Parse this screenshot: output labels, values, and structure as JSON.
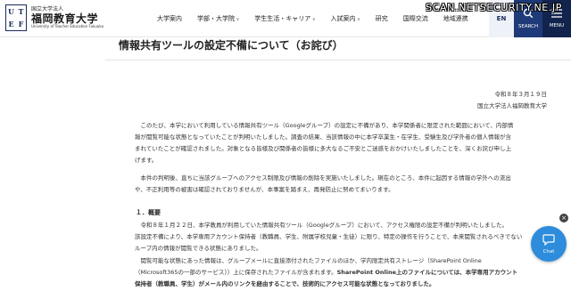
{
  "header": {
    "logo": {
      "mark": [
        "U",
        "T",
        "E",
        "F"
      ],
      "small": "国立大学法人",
      "name": "福岡教育大学",
      "en": "University of Teacher Education Fukuoka"
    },
    "nav": [
      {
        "label": "大学案内",
        "chevron": false
      },
      {
        "label": "学部・大学院",
        "chevron": true
      },
      {
        "label": "学生生活・キャリア",
        "chevron": true
      },
      {
        "label": "入試案内",
        "chevron": true
      },
      {
        "label": "研究",
        "chevron": false
      },
      {
        "label": "国際交流",
        "chevron": false
      },
      {
        "label": "地域連携",
        "chevron": false
      }
    ],
    "lang_label": "EN",
    "search_label": "SEARCH",
    "menu_label": "MENU"
  },
  "overlay_text": "SCAN.NETSECURITY.NE.JP",
  "icons": {
    "search": "search-icon",
    "menu": "menu-icon",
    "chat": "chat-icon",
    "close": "close-icon"
  },
  "article": {
    "title": "情報共有ツールの設定不備について（お詫び）",
    "date": "令和８年３月１９日",
    "organization": "国立大学法人福岡教育大学",
    "paragraph1": [
      "このたび、本学において利用している情報共有ツール（Googleグループ）の設定に不備があり、本学関係者に限定された範囲において、内部情",
      "報が閲覧可能な状態となっていたことが判明いたしました。調査の結果、当該情報の中に本学卒業生・在学生、受験生及び学外者の個人情報が含",
      "まれていたことが確認されました。対象となる皆様及び関係者の皆様に多大なるご不安とご迷惑をおかけいたしましたことを、深くお詫び申し上",
      "げます。"
    ],
    "paragraph2": [
      "本件の判明後、直ちに当該グループへのアクセス制限及び情報の削除を実施いたしました。現在のところ、本件に起因する情報の学外への流出",
      "や、不正利用等の被害は確認されておりませんが、本事案を踏まえ、再発防止に努めてまいります。"
    ],
    "section1_heading": "１．概要",
    "paragraph3": [
      "令和８年１月２２日、本学教員が利用していた情報共有ツール（Googleグループ）において、アクセス権限の設定不備が判明いたしました。",
      "該設定不備により、本学専用アカウント保持者（教職員、学生、附属学校児童・生徒）に限り、特定の操作を行うことで、本来閲覧されるべきでない",
      "ループ内の情報が閲覧できる状態にありました。"
    ],
    "paragraph4_line1": "閲覧可能な状態にあった情報は、グループメールに直接添付されたファイルのほか、学内限定共有ストレージ（SharePoint Online",
    "paragraph4_line2": "（Microsoft365の一部のサービス））上に保存されたファイルが含まれます。",
    "paragraph4_line2_bold": "SharePoint Online上のファイルについては、本学専用アカウント",
    "paragraph4_line3_bold": "保持者（教職員、学生）がメール内のリンクを経由することで、技術的にアクセス可能な状態となっておりました。"
  },
  "chat": {
    "label": "Chat",
    "close_symbol": "×"
  }
}
